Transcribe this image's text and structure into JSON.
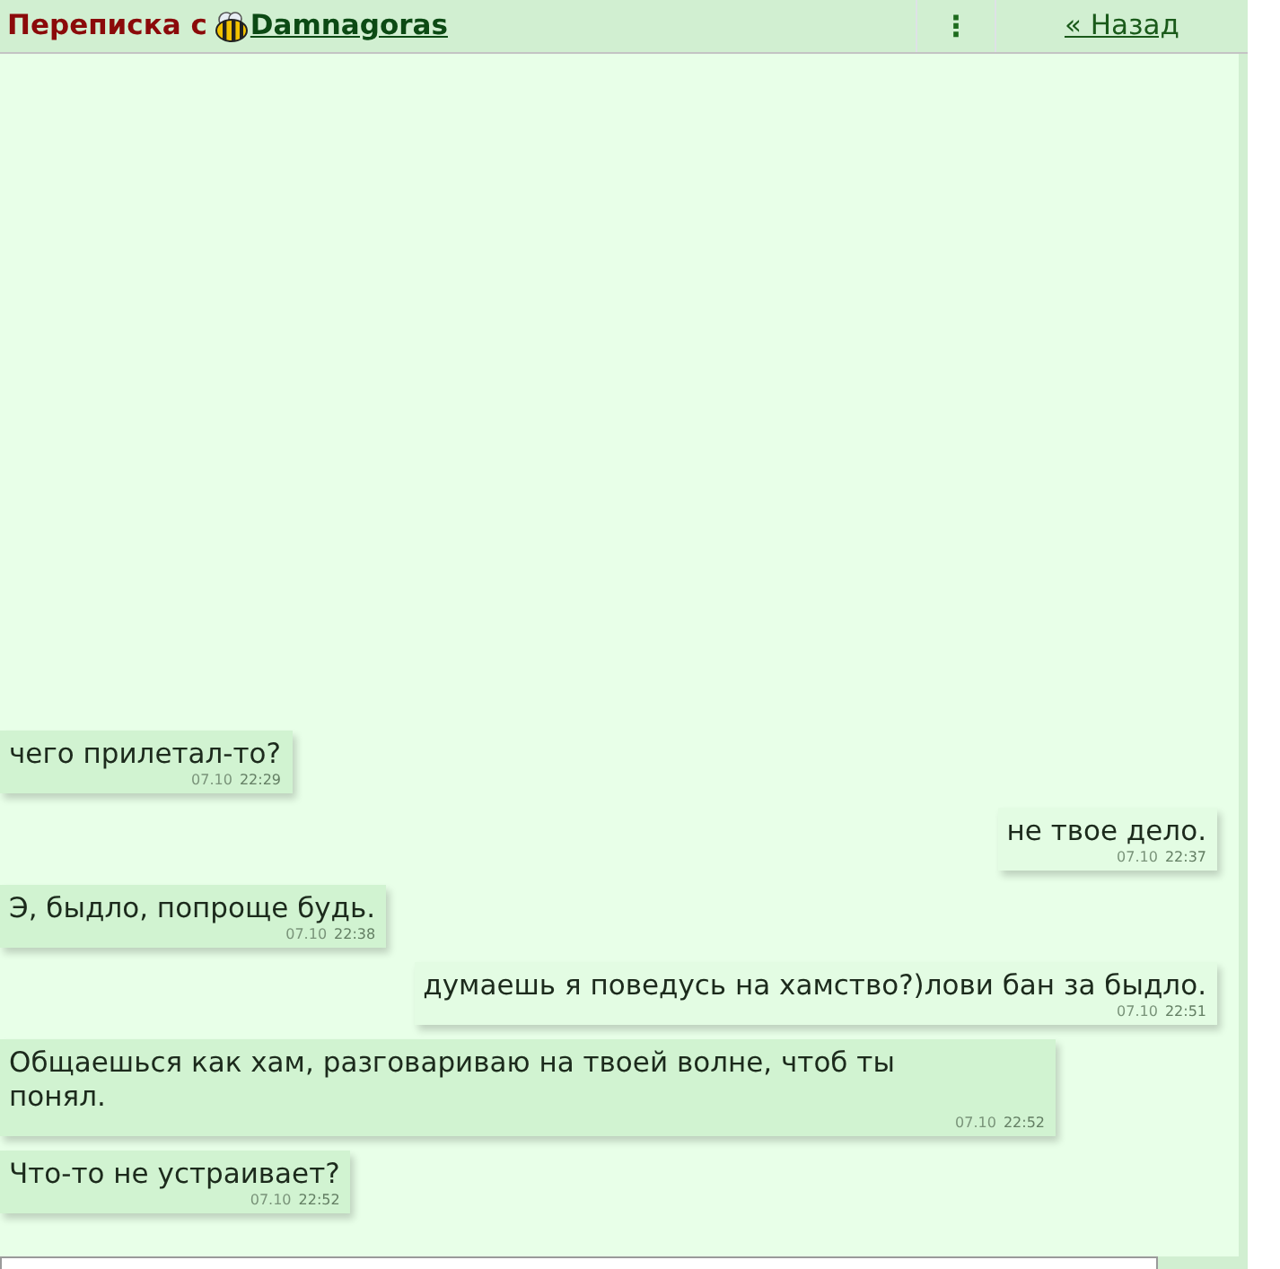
{
  "header": {
    "title": "Переписка с",
    "user": "Damnagoras",
    "menu": "⋮",
    "back": "« Назад"
  },
  "messages": [
    {
      "kind": "incoming",
      "text": "чего прилетал-то?",
      "date": "07.10",
      "time": "22:29"
    },
    {
      "kind": "outgoing",
      "text": "не твое дело.",
      "date": "07.10",
      "time": "22:37"
    },
    {
      "kind": "incoming",
      "text": "Э, быдло, попроще будь.",
      "date": "07.10",
      "time": "22:38"
    },
    {
      "kind": "outgoing",
      "text": "думаешь я поведусь на хамство?)лови бан за быдло.",
      "date": "07.10",
      "time": "22:51"
    },
    {
      "kind": "incoming",
      "text": "Общаешься как хам, разговариваю на твоей волне, чтоб ты понял.",
      "date": "07.10",
      "time": "22:52"
    },
    {
      "kind": "incoming",
      "text": "Что-то не устраивает?",
      "date": "07.10",
      "time": "22:52"
    }
  ]
}
